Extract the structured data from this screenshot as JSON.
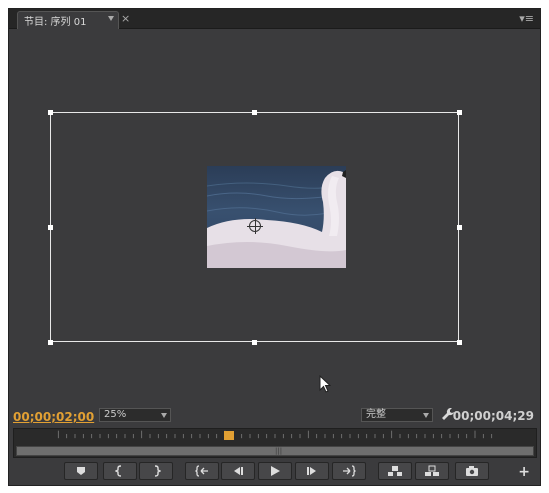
{
  "panel": {
    "tab_title": "节目: 序列 01",
    "close_glyph": "×",
    "menu_glyph": "▾≡"
  },
  "viewer": {
    "clip_subject": "swan"
  },
  "controls": {
    "current_timecode": "00;00;02;00",
    "zoom_level": "25%",
    "quality": "完整",
    "duration_timecode": "00;00;04;29",
    "playhead_fraction": 0.4
  },
  "transport": {
    "buttons": [
      {
        "icon": "add-marker-icon"
      },
      {
        "icon": "mark-in-icon"
      },
      {
        "icon": "mark-out-icon"
      },
      {
        "icon": "go-to-in-icon"
      },
      {
        "icon": "step-back-icon"
      },
      {
        "icon": "play-icon"
      },
      {
        "icon": "step-forward-icon"
      },
      {
        "icon": "go-to-out-icon"
      },
      {
        "icon": "lift-icon"
      },
      {
        "icon": "extract-icon"
      },
      {
        "icon": "export-frame-icon"
      }
    ],
    "plus_glyph": "+"
  },
  "colors": {
    "timecode_accent": "#e2a033",
    "panel_bg": "#3b3b3d"
  }
}
